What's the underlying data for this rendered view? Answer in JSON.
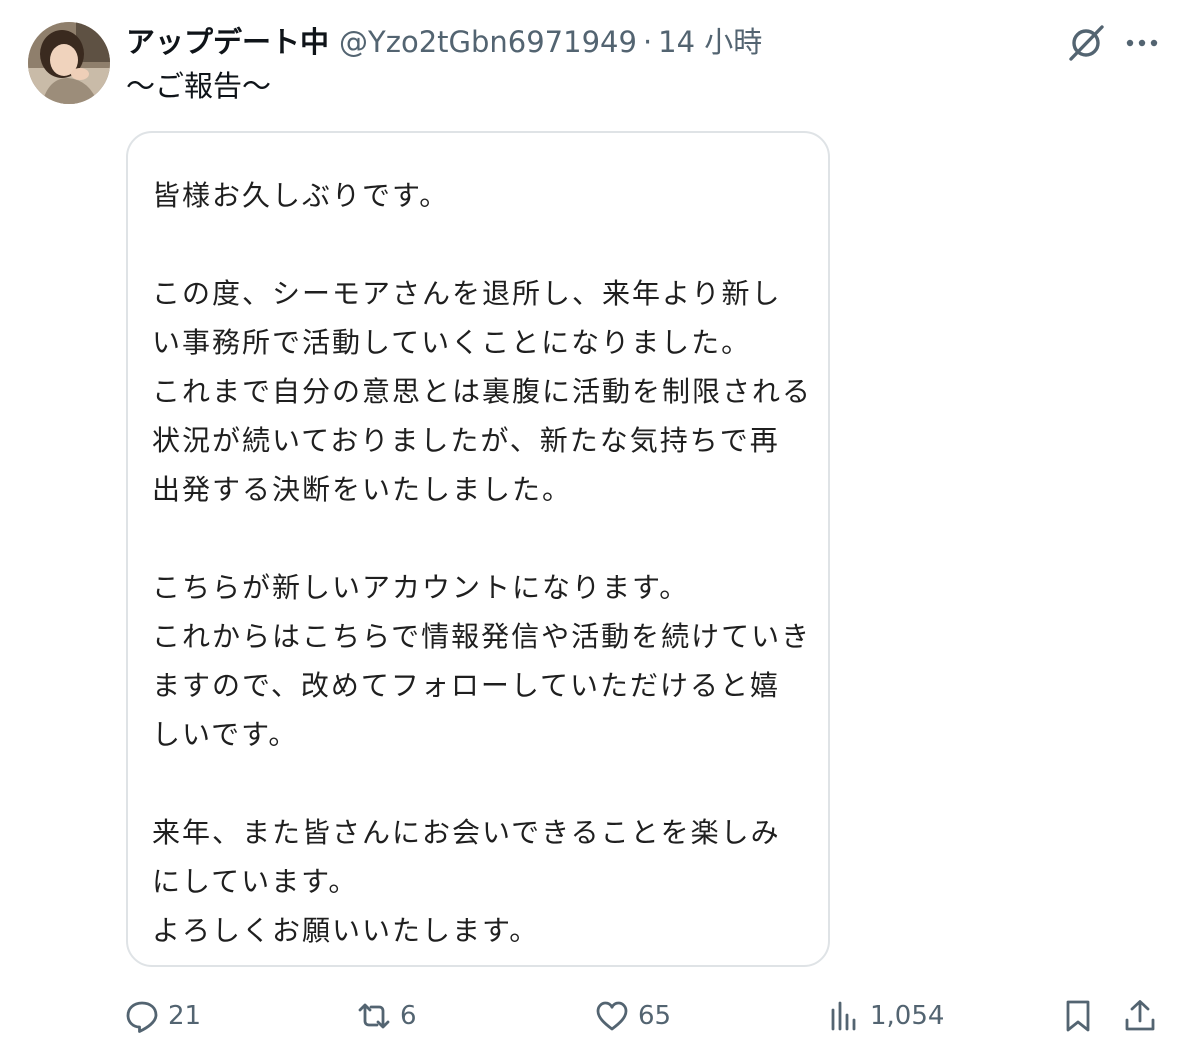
{
  "post": {
    "display_name": "アップデート中",
    "handle": "@Yzo2tGbn6971949",
    "separator": "·",
    "time": "14 小時",
    "text": "〜ご報告〜",
    "avatar_icon": "user-avatar-photo"
  },
  "header_icons": {
    "grok": "grok-icon",
    "more": "more-icon"
  },
  "image_text": {
    "lines": [
      "皆様お久しぶりです。",
      "",
      "この度、シーモアさんを退所し、来年より新し",
      "い事務所で活動していくことになりました。",
      "これまで自分の意思とは裏腹に活動を制限される",
      "状況が続いておりましたが、新たな気持ちで再",
      "出発する決断をいたしました。",
      "",
      "こちらが新しいアカウントになります。",
      "これからはこちらで情報発信や活動を続けていき",
      "ますので、改めてフォローしていただけると嬉",
      "しいです。",
      "",
      "来年、また皆さんにお会いできることを楽しみ",
      "にしています。",
      "よろしくお願いいたします。"
    ]
  },
  "actions": {
    "replies": "21",
    "reposts": "6",
    "likes": "65",
    "views": "1,054"
  },
  "colors": {
    "text": "#0f1419",
    "secondary": "#536471",
    "border": "#dfe3e6"
  }
}
